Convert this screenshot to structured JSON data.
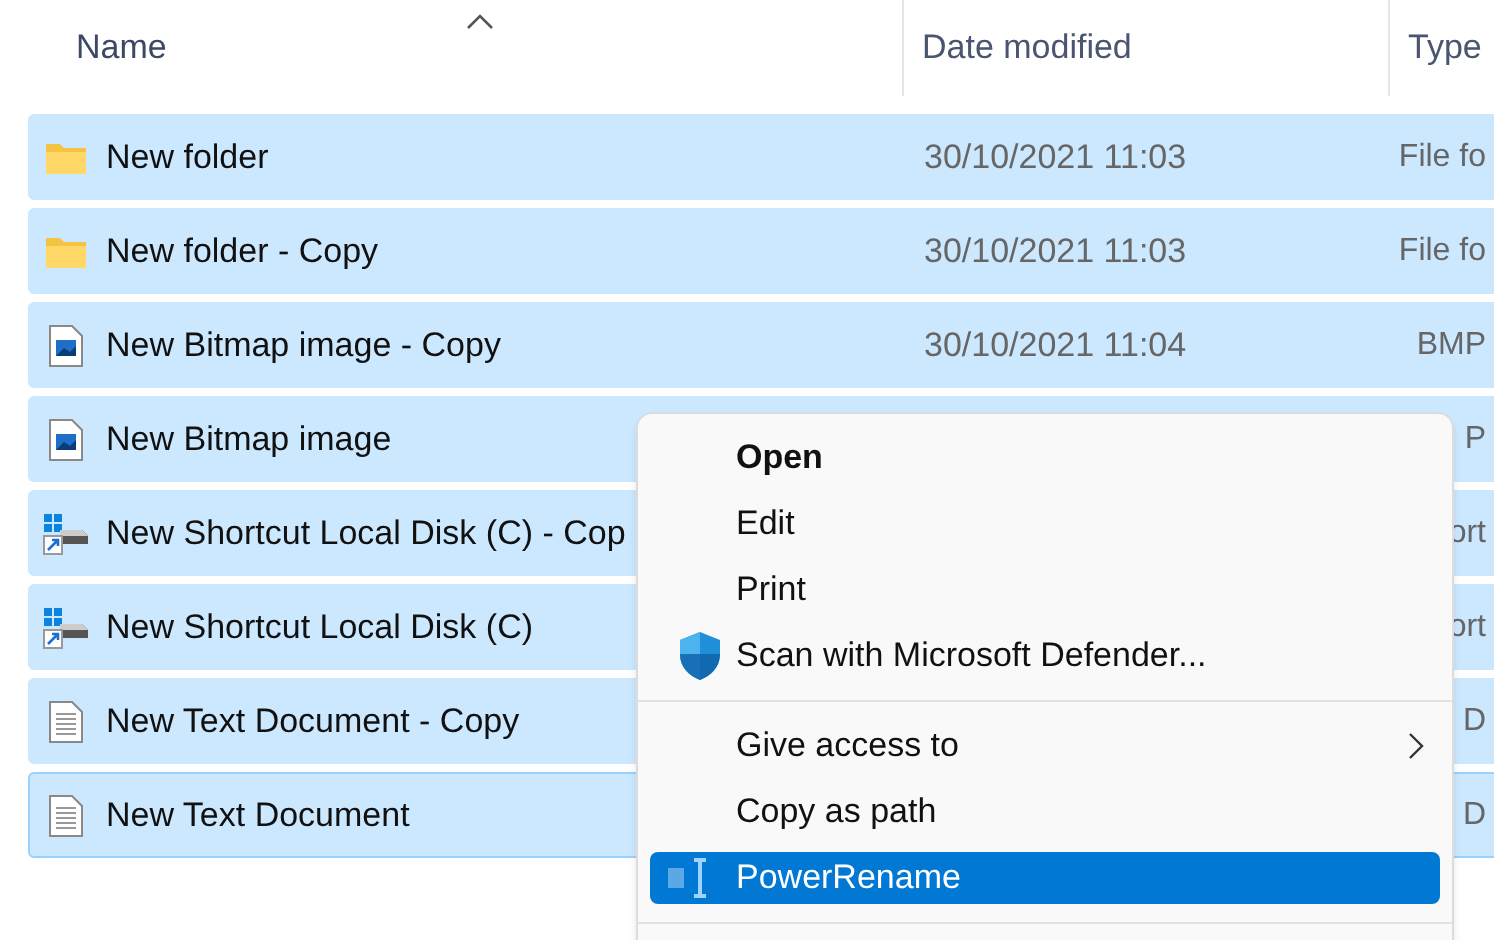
{
  "columns": [
    {
      "label": "Name",
      "sorted": true
    },
    {
      "label": "Date modified",
      "sorted": false
    },
    {
      "label": "Type",
      "sorted": false
    }
  ],
  "rows": [
    {
      "kind": "folder",
      "name": "New folder",
      "date": "30/10/2021 11:03",
      "type": "File fo",
      "selected": true,
      "focused": false
    },
    {
      "kind": "folder",
      "name": "New folder - Copy",
      "date": "30/10/2021 11:03",
      "type": "File fo",
      "selected": true,
      "focused": false
    },
    {
      "kind": "bitmap",
      "name": "New Bitmap image - Copy",
      "date": "30/10/2021 11:04",
      "type": "BMP",
      "selected": true,
      "focused": false
    },
    {
      "kind": "bitmap",
      "name": "New Bitmap image",
      "type": "P",
      "selected": true,
      "focused": false
    },
    {
      "kind": "shortcut",
      "name": "New Shortcut Local Disk (C) - Cop",
      "type": "ort",
      "selected": true,
      "focused": false
    },
    {
      "kind": "shortcut",
      "name": "New Shortcut Local Disk (C)",
      "type": "ort",
      "selected": true,
      "focused": false
    },
    {
      "kind": "text",
      "name": "New Text Document - Copy",
      "type": "D",
      "selected": true,
      "focused": false
    },
    {
      "kind": "text",
      "name": "New Text Document",
      "type": "D",
      "selected": true,
      "focused": true
    }
  ],
  "context_menu": {
    "items": [
      {
        "kind": "item",
        "label": "Open",
        "default": true,
        "submenu": false,
        "selected": false
      },
      {
        "kind": "item",
        "label": "Edit",
        "default": false,
        "submenu": false,
        "selected": false
      },
      {
        "kind": "item",
        "label": "Print",
        "default": false,
        "submenu": false,
        "selected": false
      },
      {
        "kind": "item",
        "label": "Scan with Microsoft Defender...",
        "default": false,
        "submenu": false,
        "selected": false
      },
      {
        "kind": "separator"
      },
      {
        "kind": "item",
        "label": "Give access to",
        "default": false,
        "submenu": true,
        "selected": false
      },
      {
        "kind": "item",
        "label": "Copy as path",
        "default": false,
        "submenu": false,
        "selected": false
      },
      {
        "kind": "item",
        "label": "PowerRename",
        "default": false,
        "submenu": false,
        "selected": true
      },
      {
        "kind": "separator"
      }
    ]
  }
}
